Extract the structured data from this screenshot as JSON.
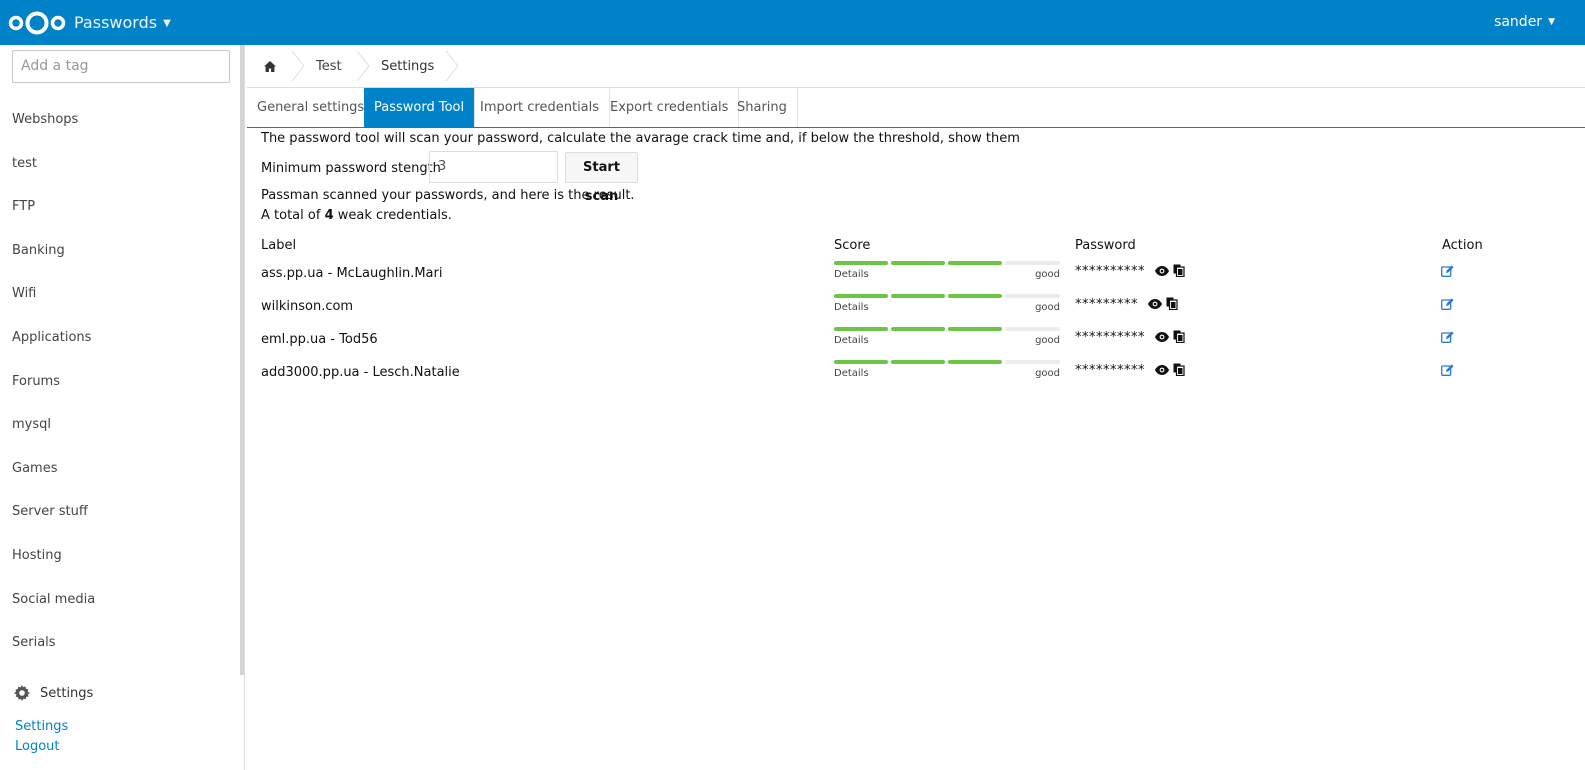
{
  "header": {
    "app_name": "Passwords",
    "user": "sander"
  },
  "sidebar": {
    "tag_placeholder": "Add a tag",
    "tags": [
      "Webshops",
      "test",
      "FTP",
      "Banking",
      "Wifi",
      "Applications",
      "Forums",
      "mysql",
      "Games",
      "Server stuff",
      "Hosting",
      "Social media",
      "Serials"
    ],
    "settings_title": "Settings",
    "links": [
      "Settings",
      "Logout"
    ]
  },
  "breadcrumb": {
    "items": [
      "Test",
      "Settings"
    ]
  },
  "tabs": [
    "General settings",
    "Password Tool",
    "Import credentials",
    "Export credentials",
    "Sharing"
  ],
  "tool": {
    "description": "The password tool will scan your password, calculate the avarage crack time and, if below the threshold, show them",
    "min_label": "Minimum password stength",
    "min_value": "3",
    "scan_button": "Start scan",
    "result_line1": "Passman scanned your passwords, and here is the result.",
    "result_prefix": "A total of",
    "result_count": "4",
    "result_suffix": "weak credentials."
  },
  "table": {
    "headers": {
      "label": "Label",
      "score": "Score",
      "password": "Password",
      "action": "Action"
    },
    "rows": [
      {
        "label": "ass.pp.ua - McLaughlin.Mari",
        "score_details": "Details",
        "score_word": "good",
        "score_level": 3,
        "score_max": 4,
        "password": "**********"
      },
      {
        "label": "wilkinson.com",
        "score_details": "Details",
        "score_word": "good",
        "score_level": 3,
        "score_max": 4,
        "password": "*********"
      },
      {
        "label": "eml.pp.ua - Tod56",
        "score_details": "Details",
        "score_word": "good",
        "score_level": 3,
        "score_max": 4,
        "password": "**********"
      },
      {
        "label": "add3000.pp.ua - Lesch.Natalie",
        "score_details": "Details",
        "score_word": "good",
        "score_level": 3,
        "score_max": 4,
        "password": "**********"
      }
    ]
  },
  "colors": {
    "brand": "#0082c9",
    "score_good": "#6cc644",
    "link": "#0082c9"
  }
}
